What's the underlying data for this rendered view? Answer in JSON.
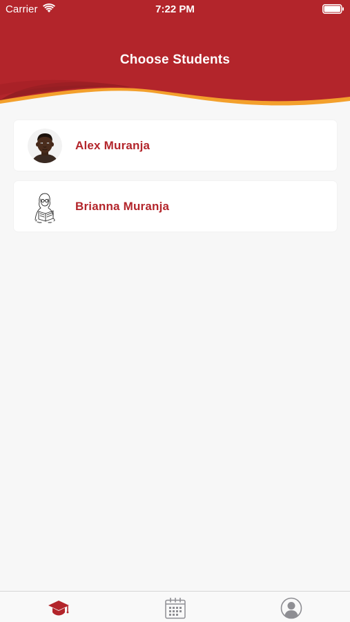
{
  "status_bar": {
    "carrier": "Carrier",
    "time": "7:22 PM"
  },
  "header": {
    "title": "Choose Students"
  },
  "students": [
    {
      "name": "Alex Muranja",
      "avatar_icon": "boy-avatar-icon"
    },
    {
      "name": "Brianna Muranja",
      "avatar_icon": "girl-reading-avatar-icon"
    }
  ],
  "tab_bar": {
    "tabs": [
      {
        "icon": "graduation-cap-icon",
        "active": true
      },
      {
        "icon": "calendar-icon",
        "active": false
      },
      {
        "icon": "profile-icon",
        "active": false
      }
    ]
  },
  "colors": {
    "header_red": "#b3252b",
    "header_dark_red": "#8f1d22",
    "wave_orange": "#f3a02c",
    "name_red": "#b3252b",
    "background": "#f7f7f7",
    "tab_active": "#b3252b",
    "tab_inactive": "#8e8e93"
  }
}
